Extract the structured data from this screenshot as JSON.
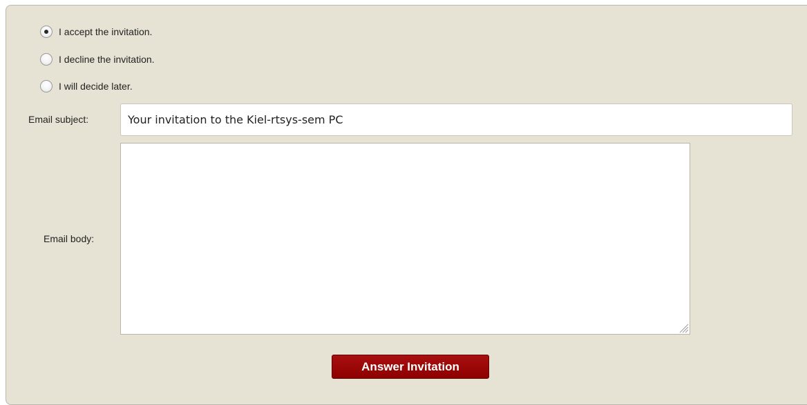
{
  "invitation_options": [
    {
      "label": "I accept the invitation.",
      "checked": true
    },
    {
      "label": "I decline the invitation.",
      "checked": false
    },
    {
      "label": "I will decide later.",
      "checked": false
    }
  ],
  "email_subject": {
    "label": "Email subject:",
    "value": "Your invitation to the Kiel-rtsys-sem PC"
  },
  "email_body": {
    "label": "Email body:",
    "value": ""
  },
  "submit": {
    "label": "Answer Invitation"
  },
  "colors": {
    "panel_background": "#e6e2d4",
    "button_background": "#9b0000",
    "button_text": "#ffffff"
  }
}
